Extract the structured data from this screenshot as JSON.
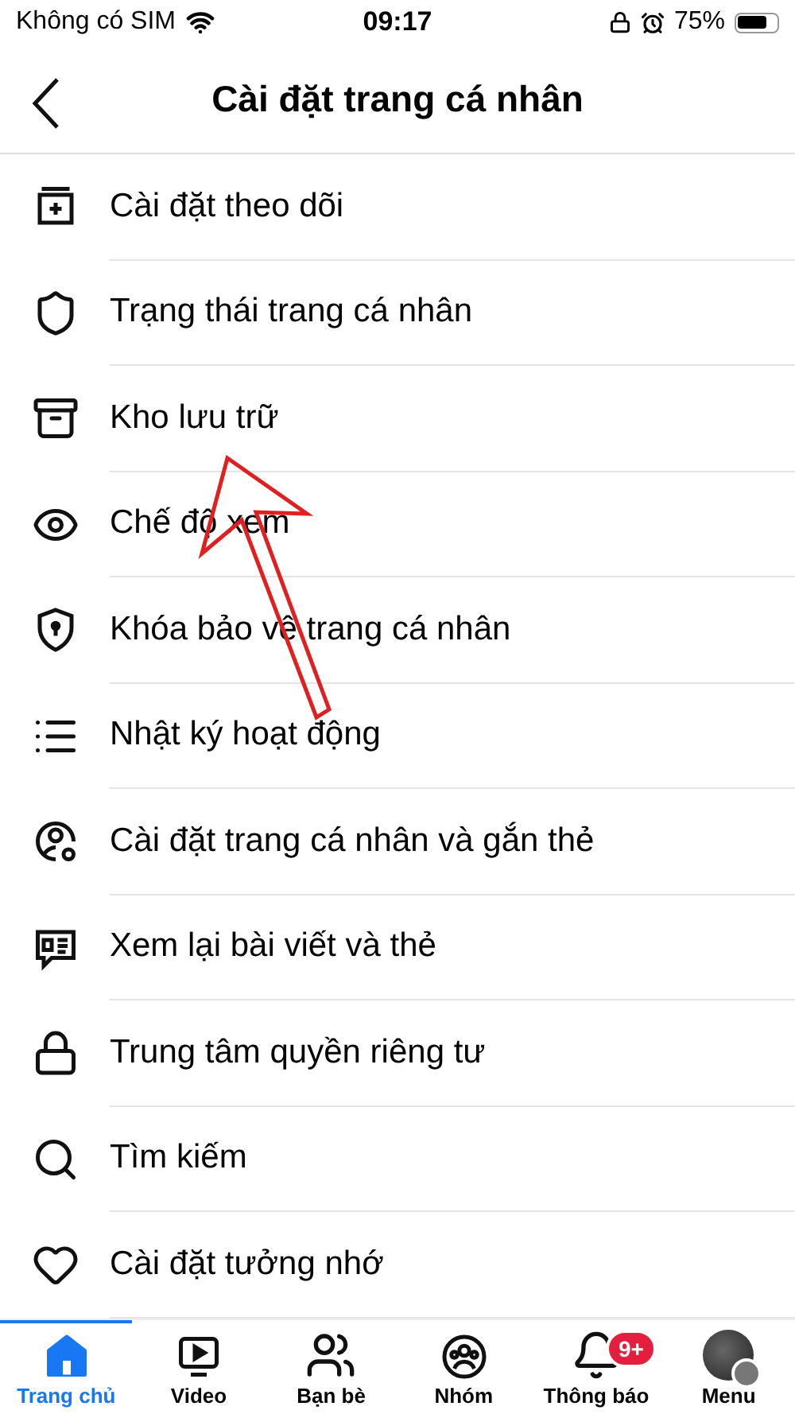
{
  "status_bar": {
    "carrier": "Không có SIM",
    "time": "09:17",
    "battery": "75%"
  },
  "header": {
    "title": "Cài đặt trang cá nhân"
  },
  "items": [
    {
      "label": "Cài đặt theo dõi",
      "kind": "follow"
    },
    {
      "label": "Trạng thái trang cá nhân",
      "kind": "status"
    },
    {
      "label": "Kho lưu trữ",
      "kind": "archive"
    },
    {
      "label": "Chế độ xem",
      "kind": "view"
    },
    {
      "label": "Khóa bảo vệ trang cá nhân",
      "kind": "lock-shield"
    },
    {
      "label": "Nhật ký hoạt động",
      "kind": "activity"
    },
    {
      "label": "Cài đặt trang cá nhân và gắn thẻ",
      "kind": "tagging"
    },
    {
      "label": "Xem lại bài viết và thẻ",
      "kind": "review"
    },
    {
      "label": "Trung tâm quyền riêng tư",
      "kind": "privacy"
    },
    {
      "label": "Tìm kiếm",
      "kind": "search"
    },
    {
      "label": "Cài đặt tưởng nhớ",
      "kind": "memorial"
    }
  ],
  "tab_bar": [
    {
      "label": "Trang chủ",
      "kind": "home",
      "selected": true
    },
    {
      "label": "Video",
      "kind": "video",
      "selected": false
    },
    {
      "label": "Bạn bè",
      "kind": "friends",
      "selected": false
    },
    {
      "label": "Nhóm",
      "kind": "groups",
      "selected": false
    },
    {
      "label": "Thông báo",
      "kind": "notifications",
      "selected": false,
      "badge": "9+"
    },
    {
      "label": "Menu",
      "kind": "menu",
      "selected": false
    }
  ]
}
